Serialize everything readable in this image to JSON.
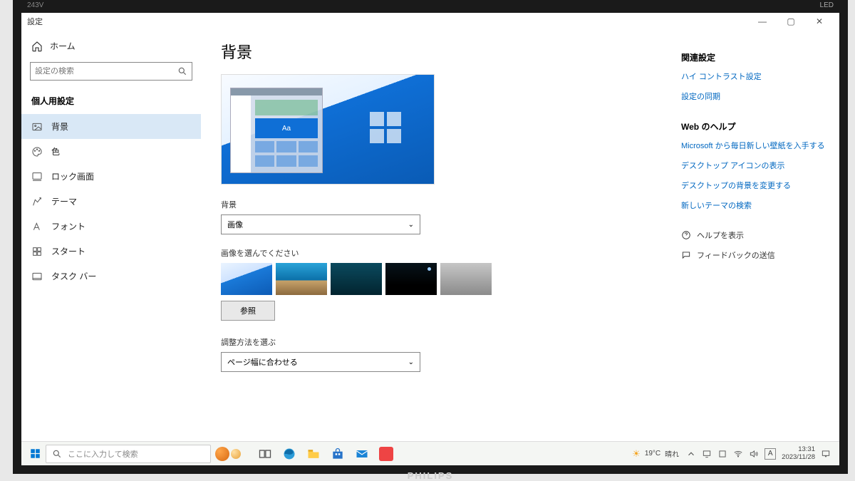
{
  "window": {
    "title": "設定"
  },
  "controls": {
    "min": "—",
    "restore": "▢",
    "close": "✕"
  },
  "sidebar": {
    "home": "ホーム",
    "search_placeholder": "設定の検索",
    "section": "個人用設定",
    "items": [
      {
        "label": "背景",
        "icon": "image-icon",
        "selected": true
      },
      {
        "label": "色",
        "icon": "palette-icon"
      },
      {
        "label": "ロック画面",
        "icon": "lock-screen-icon"
      },
      {
        "label": "テーマ",
        "icon": "theme-icon"
      },
      {
        "label": "フォント",
        "icon": "font-icon"
      },
      {
        "label": "スタート",
        "icon": "start-icon"
      },
      {
        "label": "タスク バー",
        "icon": "taskbar-icon"
      }
    ]
  },
  "main": {
    "heading": "背景",
    "preview_sample": "Aa",
    "bg_label": "背景",
    "bg_value": "画像",
    "choose_label": "画像を選んでください",
    "browse": "参照",
    "fit_label": "調整方法を選ぶ",
    "fit_value": "ページ幅に合わせる"
  },
  "right": {
    "related_title": "関連設定",
    "related_links": [
      "ハイ コントラスト設定",
      "設定の同期"
    ],
    "web_title": "Web のヘルプ",
    "web_links": [
      "Microsoft から毎日新しい壁紙を入手する",
      "デスクトップ アイコンの表示",
      "デスクトップの背景を変更する",
      "新しいテーマの検索"
    ],
    "help": "ヘルプを表示",
    "feedback": "フィードバックの送信"
  },
  "taskbar": {
    "search_placeholder": "ここに入力して検索",
    "weather_temp": "19°C",
    "weather_cond": "晴れ",
    "ime": "A",
    "time": "13:31",
    "date": "2023/11/28"
  },
  "monitor": {
    "model": "243V",
    "led": "LED",
    "brand": "PHILIPS"
  }
}
